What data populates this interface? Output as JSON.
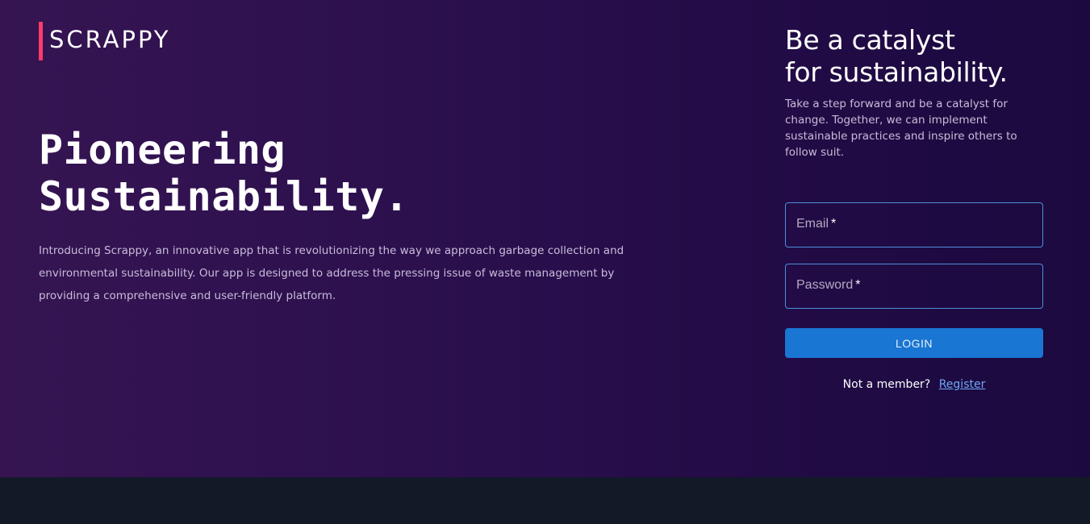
{
  "brand": {
    "name": "SCRAPPY",
    "accent_color": "#ff3b6b"
  },
  "hero": {
    "headline_line1": "Pioneering",
    "headline_line2": "Sustainability.",
    "intro": "Introducing Scrappy, an innovative app that is revolutionizing the way we approach garbage collection and environmental sustainability. Our app is designed to address the pressing issue of waste management by providing a comprehensive and user-friendly platform."
  },
  "login_panel": {
    "title_line1": "Be a catalyst",
    "title_line2": "for sustainability.",
    "subtitle": "Take a step forward and be a catalyst for change. Together, we can implement sustainable practices and inspire others to follow suit.",
    "email_label": "Email",
    "password_label": "Password",
    "required_mark": "*",
    "email_value": "",
    "password_value": "",
    "login_label": "LOGIN",
    "not_member_text": "Not a member?",
    "register_label": "Register"
  },
  "colors": {
    "button": "#1976d2",
    "field_border": "#4e8fdc",
    "link": "#6ea8f5"
  }
}
